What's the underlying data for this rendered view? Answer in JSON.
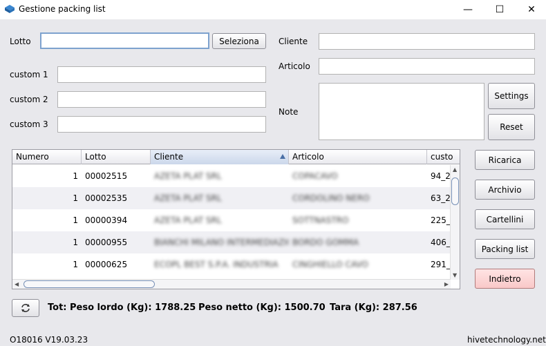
{
  "window": {
    "title": "Gestione packing list",
    "minimize": "—",
    "maximize": "☐",
    "close": "✕"
  },
  "form": {
    "lotto_label": "Lotto",
    "lotto_value": "",
    "seleziona_label": "Seleziona",
    "custom1_label": "custom 1",
    "custom1_value": "",
    "custom2_label": "custom 2",
    "custom2_value": "",
    "custom3_label": "custom 3",
    "custom3_value": "",
    "cliente_label": "Cliente",
    "cliente_value": "",
    "articolo_label": "Articolo",
    "articolo_value": "",
    "note_label": "Note",
    "note_value": "",
    "settings_label": "Settings",
    "reset_label": "Reset"
  },
  "table": {
    "columns": [
      "Numero",
      "Lotto",
      "Cliente",
      "Articolo",
      "custo"
    ],
    "sorted_column": "Cliente",
    "rows": [
      {
        "numero": "1",
        "lotto": "00002515",
        "cliente": "AZETA PLAT SRL",
        "articolo": "COPACAVO",
        "custom": "94_2"
      },
      {
        "numero": "1",
        "lotto": "00002535",
        "cliente": "AZETA PLAT SRL",
        "articolo": "CORDOLINO NERO",
        "custom": "63_2"
      },
      {
        "numero": "1",
        "lotto": "00000394",
        "cliente": "AZETA PLAT SRL",
        "articolo": "SOTTNASTRO",
        "custom": "225_"
      },
      {
        "numero": "1",
        "lotto": "00000955",
        "cliente": "BIANCHI MILANO INTERMEDIAZIONI",
        "articolo": "BORDO GOMMA",
        "custom": "406_"
      },
      {
        "numero": "1",
        "lotto": "00000625",
        "cliente": "ECOPL BEST S.P.A. INDUSTRIA",
        "articolo": "CINGHIELLO CAVO",
        "custom": "291_"
      }
    ]
  },
  "side_buttons": {
    "ricarica": "Ricarica",
    "archivio": "Archivio",
    "cartellini": "Cartellini",
    "packing_list": "Packing list",
    "indietro": "Indietro"
  },
  "totals": {
    "lordo": "Tot: Peso lordo (Kg): 1788.25",
    "netto": "Peso netto (Kg): 1500.70",
    "tara": "Tara (Kg): 287.56"
  },
  "status": {
    "version": "O18016 V19.03.23",
    "site": "hivetechnology.net"
  },
  "colors": {
    "background": "#e8e8ec",
    "focus_border": "#7da2ce",
    "danger_button": "#f9c8c8"
  }
}
